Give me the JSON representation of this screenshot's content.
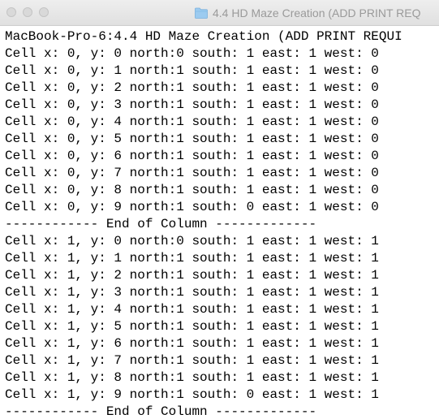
{
  "window": {
    "title": "4.4 HD Maze Creation (ADD PRINT REQ",
    "folder_icon": "folder-icon",
    "titlebar_button_color": "#d9d9d9"
  },
  "terminal": {
    "lines": [
      "MacBook-Pro-6:4.4 HD Maze Creation (ADD PRINT REQUI",
      "Cell x: 0, y: 0 north:0 south: 1 east: 1 west: 0",
      "Cell x: 0, y: 1 north:1 south: 1 east: 1 west: 0",
      "Cell x: 0, y: 2 north:1 south: 1 east: 1 west: 0",
      "Cell x: 0, y: 3 north:1 south: 1 east: 1 west: 0",
      "Cell x: 0, y: 4 north:1 south: 1 east: 1 west: 0",
      "Cell x: 0, y: 5 north:1 south: 1 east: 1 west: 0",
      "Cell x: 0, y: 6 north:1 south: 1 east: 1 west: 0",
      "Cell x: 0, y: 7 north:1 south: 1 east: 1 west: 0",
      "Cell x: 0, y: 8 north:1 south: 1 east: 1 west: 0",
      "Cell x: 0, y: 9 north:1 south: 0 east: 1 west: 0",
      "------------ End of Column -------------",
      "Cell x: 1, y: 0 north:0 south: 1 east: 1 west: 1",
      "Cell x: 1, y: 1 north:1 south: 1 east: 1 west: 1",
      "Cell x: 1, y: 2 north:1 south: 1 east: 1 west: 1",
      "Cell x: 1, y: 3 north:1 south: 1 east: 1 west: 1",
      "Cell x: 1, y: 4 north:1 south: 1 east: 1 west: 1",
      "Cell x: 1, y: 5 north:1 south: 1 east: 1 west: 1",
      "Cell x: 1, y: 6 north:1 south: 1 east: 1 west: 1",
      "Cell x: 1, y: 7 north:1 south: 1 east: 1 west: 1",
      "Cell x: 1, y: 8 north:1 south: 1 east: 1 west: 1",
      "Cell x: 1, y: 9 north:1 south: 0 east: 1 west: 1",
      "------------ End of Column -------------"
    ]
  }
}
